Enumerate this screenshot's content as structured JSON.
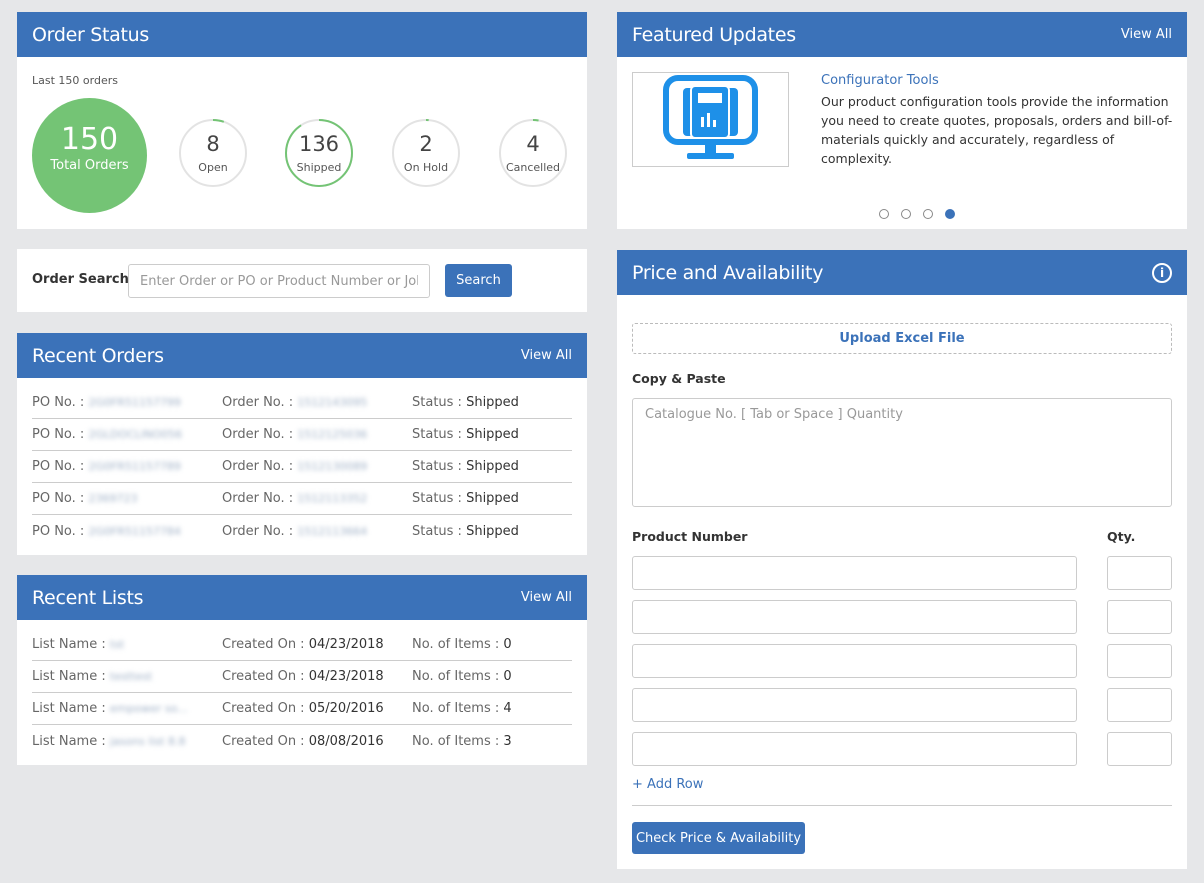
{
  "order_status": {
    "title": "Order Status",
    "subtitle": "Last 150 orders",
    "total_value": "150",
    "total_label": "Total Orders",
    "stats": [
      {
        "value": "8",
        "label": "Open",
        "fraction": 0.053
      },
      {
        "value": "136",
        "label": "Shipped",
        "fraction": 0.907
      },
      {
        "value": "2",
        "label": "On Hold",
        "fraction": 0.013
      },
      {
        "value": "4",
        "label": "Cancelled",
        "fraction": 0.027
      }
    ],
    "accent_color": "#74c475"
  },
  "order_search": {
    "label": "Order Search",
    "placeholder": "Enter Order or PO or Product Number or Job no",
    "button": "Search"
  },
  "recent_orders": {
    "title": "Recent Orders",
    "view_all": "View All",
    "po_label": "PO No. :",
    "order_label": "Order No. :",
    "status_label": "Status :",
    "rows": [
      {
        "po": "2G0FR51157799",
        "order": "1512143095",
        "status": "Shipped"
      },
      {
        "po": "2GLDOCLINO056",
        "order": "1512125036",
        "status": "Shipped"
      },
      {
        "po": "2G0FR51157789",
        "order": "1512130089",
        "status": "Shipped"
      },
      {
        "po": "2369723",
        "order": "1512113352",
        "status": "Shipped"
      },
      {
        "po": "2G0FR51157784",
        "order": "1512113664",
        "status": "Shipped"
      }
    ]
  },
  "recent_lists": {
    "title": "Recent Lists",
    "view_all": "View All",
    "name_label": "List Name :",
    "created_label": "Created On :",
    "items_label": "No. of Items :",
    "rows": [
      {
        "name": "tst",
        "created": "04/23/2018",
        "items": "0"
      },
      {
        "name": "testtest",
        "created": "04/23/2018",
        "items": "0"
      },
      {
        "name": "empower so...",
        "created": "05/20/2016",
        "items": "4"
      },
      {
        "name": "jasons list 8.8",
        "created": "08/08/2016",
        "items": "3"
      }
    ]
  },
  "featured": {
    "title": "Featured Updates",
    "view_all": "View All",
    "item_title": "Configurator Tools",
    "item_text": "Our product configuration tools provide the information you need to create quotes, proposals, orders and bill-of-materials quickly and accurately, regardless of complexity.",
    "image_icon": "monitor-calculator-icon",
    "slide_count": 4,
    "active_slide": 4
  },
  "price": {
    "title": "Price and Availability",
    "info_icon": "info-icon",
    "upload_label": "Upload Excel File",
    "copy_label": "Copy & Paste",
    "copy_placeholder": "Catalogue No. [ Tab or Space ] Quantity",
    "product_label": "Product Number",
    "qty_label": "Qty.",
    "row_count": 5,
    "add_row": "+ Add Row",
    "check_button": "Check Price & Availability"
  },
  "colors": {
    "brand": "#3b72b9",
    "success": "#74c475",
    "background": "#e6e7e9"
  }
}
